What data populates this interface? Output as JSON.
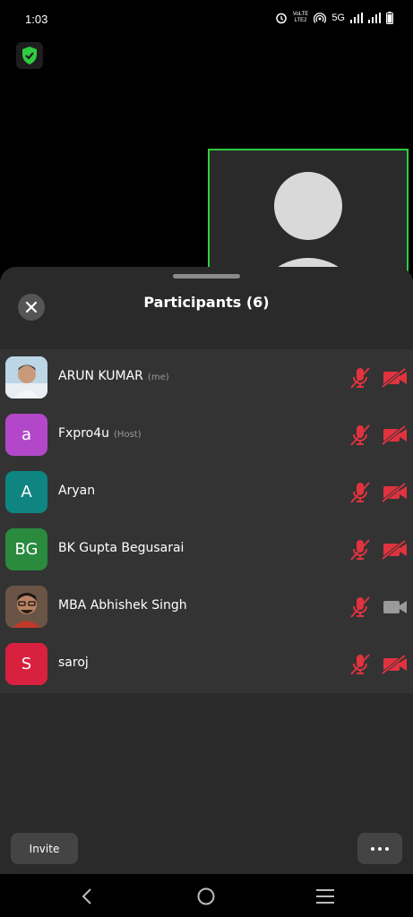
{
  "status_bar": {
    "time": "1:03",
    "lte_top": "VoLTE",
    "lte_bottom": "LTE2",
    "network": "5G"
  },
  "sheet": {
    "title": "Participants (6)"
  },
  "participants": [
    {
      "name": "ARUN KUMAR",
      "tag": "(me)",
      "avatar_type": "photo",
      "mic": "muted",
      "camera": "off"
    },
    {
      "name": "Fxpro4u",
      "tag": "(Host)",
      "avatar_letter": "a",
      "avatar_color": "#b248c9",
      "mic": "muted",
      "camera": "off"
    },
    {
      "name": "Aryan",
      "tag": "",
      "avatar_letter": "A",
      "avatar_color": "#0f8582",
      "mic": "muted",
      "camera": "off"
    },
    {
      "name": "BK Gupta Begusarai",
      "tag": "",
      "avatar_letter": "BG",
      "avatar_color": "#2a8a3e",
      "mic": "muted",
      "camera": "off"
    },
    {
      "name": "MBA Abhishek Singh",
      "tag": "",
      "avatar_type": "photo",
      "mic": "muted",
      "camera": "on"
    },
    {
      "name": "saroj",
      "tag": "",
      "avatar_letter": "S",
      "avatar_color": "#d8213f",
      "mic": "muted",
      "camera": "off"
    }
  ],
  "footer": {
    "invite_label": "Invite"
  },
  "colors": {
    "active_border": "#2ecc40",
    "muted_red": "#e0333f",
    "sheet_bg": "#2a2a2a",
    "list_bg": "#333333"
  },
  "icons": [
    "alarm-icon",
    "hotspot-icon",
    "signal-icon",
    "battery-icon",
    "shield-check-icon",
    "close-icon",
    "mic-off-icon",
    "video-off-icon",
    "video-on-icon",
    "more-icon",
    "back-icon",
    "home-icon",
    "recents-icon"
  ]
}
